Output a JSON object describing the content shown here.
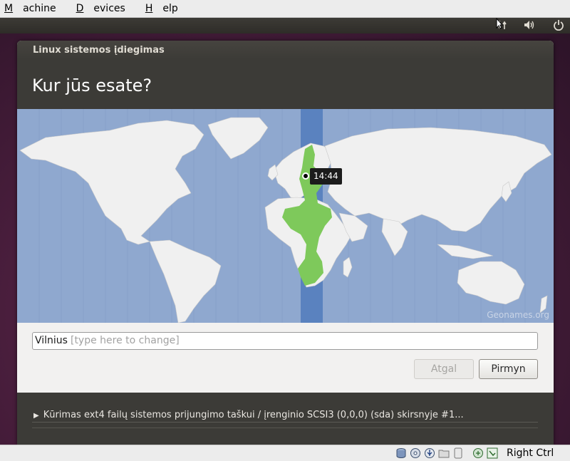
{
  "host_menu": {
    "items": [
      {
        "label": "Machine",
        "u": "M",
        "rest": "achine"
      },
      {
        "label": "Devices",
        "u": "D",
        "rest": "evices"
      },
      {
        "label": "Help",
        "u": "H",
        "rest": "elp"
      }
    ]
  },
  "guest_panel": {
    "icons": [
      "network-icon",
      "volume-icon",
      "power-icon"
    ]
  },
  "installer": {
    "window_title": "Linux sistemos įdiegimas",
    "heading": "Kur jūs esate?",
    "map": {
      "tooltip_time": "14:44",
      "credit": "Geonames.org",
      "land_color": "#f0f0f0",
      "ocean_color": "#8fa8cf",
      "timezone_highlight_color": "#7ec95b"
    },
    "location_input": {
      "value": "Vilnius",
      "placeholder": "[type here to change]"
    },
    "buttons": {
      "back": "Atgal",
      "forward": "Pirmyn"
    },
    "progress": {
      "text": "Kūrimas ext4 failų sistemos prijungimo taškui / įrenginio SCSI3 (0,0,0) (sda) skirsnyje #1..."
    }
  },
  "host_status": {
    "icons": [
      "hard-disk-icon",
      "optical-disk-icon",
      "usb-icon",
      "shared-folder-icon",
      "display-icon",
      "network-adapter-icon",
      "host-key-arrow-icon"
    ],
    "host_key": "Right Ctrl"
  }
}
